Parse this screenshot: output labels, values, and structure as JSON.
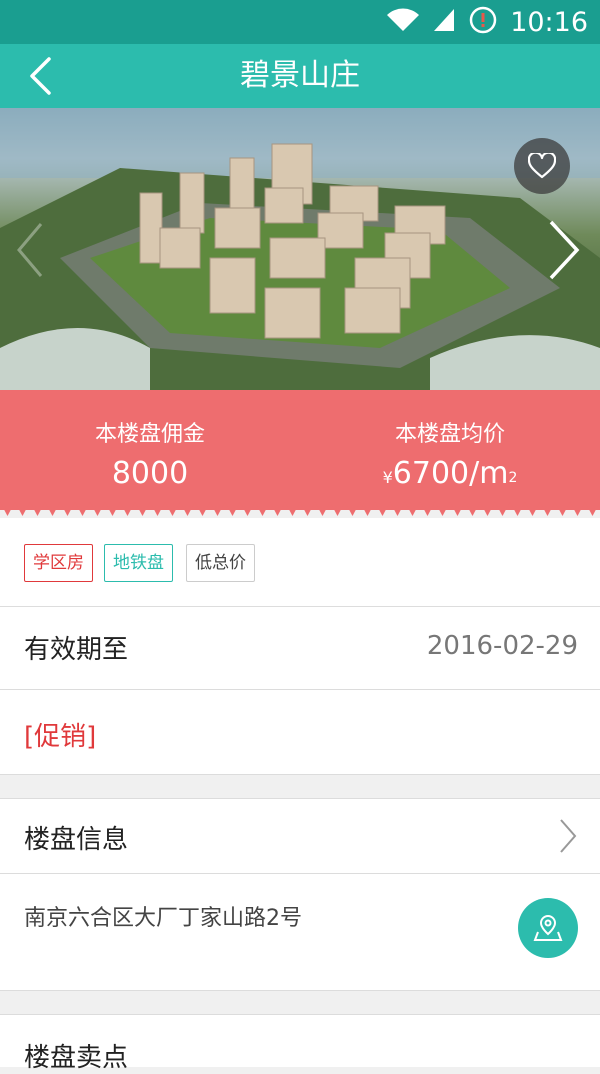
{
  "status_bar": {
    "time": "10:16"
  },
  "header": {
    "title": "碧景山庄"
  },
  "hero": {
    "image": "aerial-rendering-of-residential-complex"
  },
  "price_band": {
    "commission_label": "本楼盘佣金",
    "commission_value": "8000",
    "avg_price_label": "本楼盘均价",
    "avg_price_currency": "¥",
    "avg_price_value": "6700/m",
    "avg_price_unit_sup": "2",
    "color": "#ee6d6f"
  },
  "tags": [
    {
      "label": "学区房",
      "color": "#e0393b"
    },
    {
      "label": "地铁盘",
      "color": "#2cbcad"
    },
    {
      "label": "低总价",
      "color": "#444444"
    }
  ],
  "validity": {
    "label": "有效期至",
    "value": "2016-02-29"
  },
  "promo": {
    "label": "[促销]",
    "color": "#e0393b"
  },
  "info": {
    "label": "楼盘信息",
    "address": "南京六合区大厂丁家山路2号"
  },
  "selling_points": {
    "label": "楼盘卖点"
  },
  "colors": {
    "accent": "#2cbcad",
    "status": "#1a9e90"
  }
}
